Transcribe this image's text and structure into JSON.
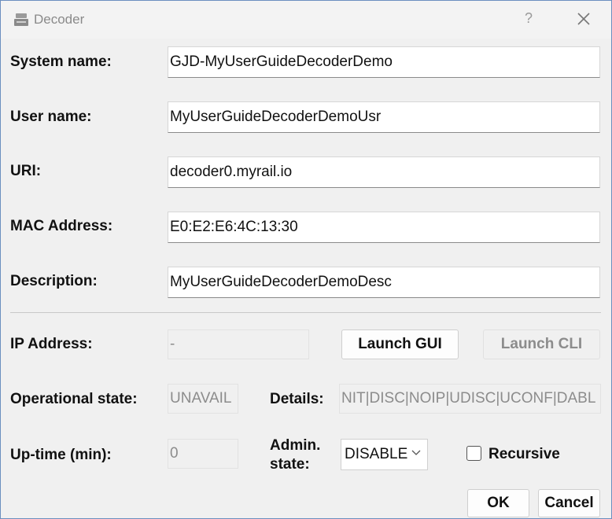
{
  "window": {
    "title": "Decoder",
    "help": "?"
  },
  "fields": {
    "system_name": {
      "label": "System name:",
      "value": "GJD-MyUserGuideDecoderDemo"
    },
    "user_name": {
      "label": "User name:",
      "value": "MyUserGuideDecoderDemoUsr"
    },
    "uri": {
      "label": "URI:",
      "value": "decoder0.myrail.io"
    },
    "mac": {
      "label": "MAC Address:",
      "value": "E0:E2:E6:4C:13:30"
    },
    "description": {
      "label": "Description:",
      "value": "MyUserGuideDecoderDemoDesc"
    }
  },
  "status": {
    "ip_label": "IP Address:",
    "ip_value": "-",
    "launch_gui": "Launch GUI",
    "launch_cli": "Launch CLI",
    "op_state_label": "Operational state:",
    "op_state_value": "UNAVAIL",
    "details_label": "Details:",
    "details_value": "NIT|DISC|NOIP|UDISC|UCONF|DABL",
    "uptime_label": "Up-time (min):",
    "uptime_value": "0",
    "admin_label_line1": "Admin.",
    "admin_label_line2": "state:",
    "admin_value": "DISABLE",
    "recursive_label": "Recursive"
  },
  "buttons": {
    "ok": "OK",
    "cancel": "Cancel"
  },
  "icons": {
    "app": "decoder-icon",
    "close": "close-icon",
    "dropdown": "chevron-down-icon"
  }
}
